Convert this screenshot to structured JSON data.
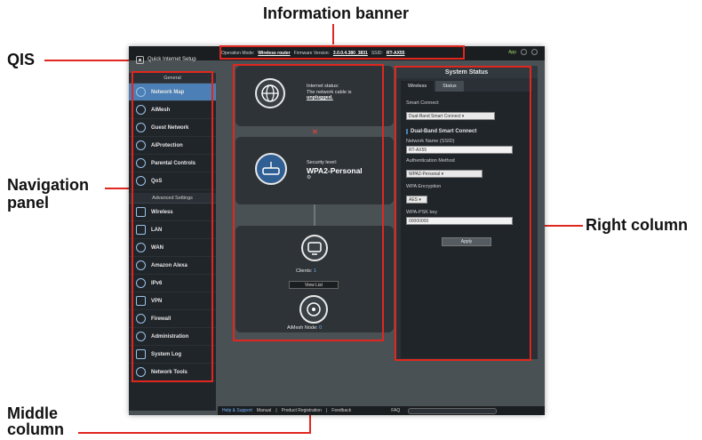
{
  "callouts": {
    "information_banner": "Information banner",
    "qis": "QIS",
    "navigation_panel_line1": "Navigation",
    "navigation_panel_line2": "panel",
    "right_column": "Right column",
    "middle_column_line1": "Middle",
    "middle_column_line2": "column"
  },
  "topbar": {
    "qis_label": "Quick Internet Setup",
    "operation_mode_label": "Operation Mode:",
    "operation_mode_value": "Wireless router",
    "firmware_label": "Firmware Version:",
    "firmware_value": "3.0.0.4.380_3831",
    "ssid_label": "SSID:",
    "ssid_value": "RT-AX55",
    "app_label": "App"
  },
  "nav": {
    "general_header": "General",
    "general_items": [
      {
        "label": "Network Map",
        "icon": "globe-icon"
      },
      {
        "label": "AiMesh",
        "icon": "mesh-icon"
      },
      {
        "label": "Guest Network",
        "icon": "guest-icon"
      },
      {
        "label": "AiProtection",
        "icon": "shield-icon"
      },
      {
        "label": "Parental Controls",
        "icon": "family-icon"
      },
      {
        "label": "QoS",
        "icon": "gauge-icon"
      }
    ],
    "advanced_header": "Advanced Settings",
    "advanced_items": [
      {
        "label": "Wireless",
        "icon": "wifi-icon"
      },
      {
        "label": "LAN",
        "icon": "lan-icon"
      },
      {
        "label": "WAN",
        "icon": "wan-icon"
      },
      {
        "label": "Amazon Alexa",
        "icon": "alexa-icon"
      },
      {
        "label": "IPv6",
        "icon": "ipv6-icon"
      },
      {
        "label": "VPN",
        "icon": "vpn-icon"
      },
      {
        "label": "Firewall",
        "icon": "firewall-icon"
      },
      {
        "label": "Administration",
        "icon": "admin-icon"
      },
      {
        "label": "System Log",
        "icon": "log-icon"
      },
      {
        "label": "Network Tools",
        "icon": "tools-icon"
      }
    ]
  },
  "middle": {
    "internet_status_line1": "Internet status:",
    "internet_status_line2": "The network cable is",
    "internet_status_line3": "unplugged.",
    "security_level_label": "Security level:",
    "security_level_value": "WPA2-Personal",
    "clients_label": "Clients:",
    "clients_count": "1",
    "view_list_button": "View List",
    "aimesh_label": "AiMesh Node:",
    "aimesh_count": "0"
  },
  "right": {
    "title": "System Status",
    "tab_wireless": "Wireless",
    "tab_status": "Status",
    "smart_connect_label": "Smart Connect",
    "smart_connect_value": "Dual-Band Smart Connect",
    "section_title": "Dual-Band Smart Connect",
    "ssid_label": "Network Name (SSID)",
    "ssid_value": "RT-AX55",
    "auth_label": "Authentication Method",
    "auth_value": "WPA2-Personal",
    "encryption_label": "WPA Encryption",
    "encryption_value": "AES",
    "psk_label": "WPA-PSK key",
    "psk_value": "00000000",
    "apply_button": "Apply"
  },
  "footer": {
    "help_support": "Help & Support",
    "manual": "Manual",
    "product_registration": "Product Registration",
    "feedback": "Feedback",
    "faq": "FAQ"
  },
  "colors": {
    "callout_line": "#e0271f",
    "nav_active": "#4b7fb5",
    "panel_bg": "#20252a"
  }
}
